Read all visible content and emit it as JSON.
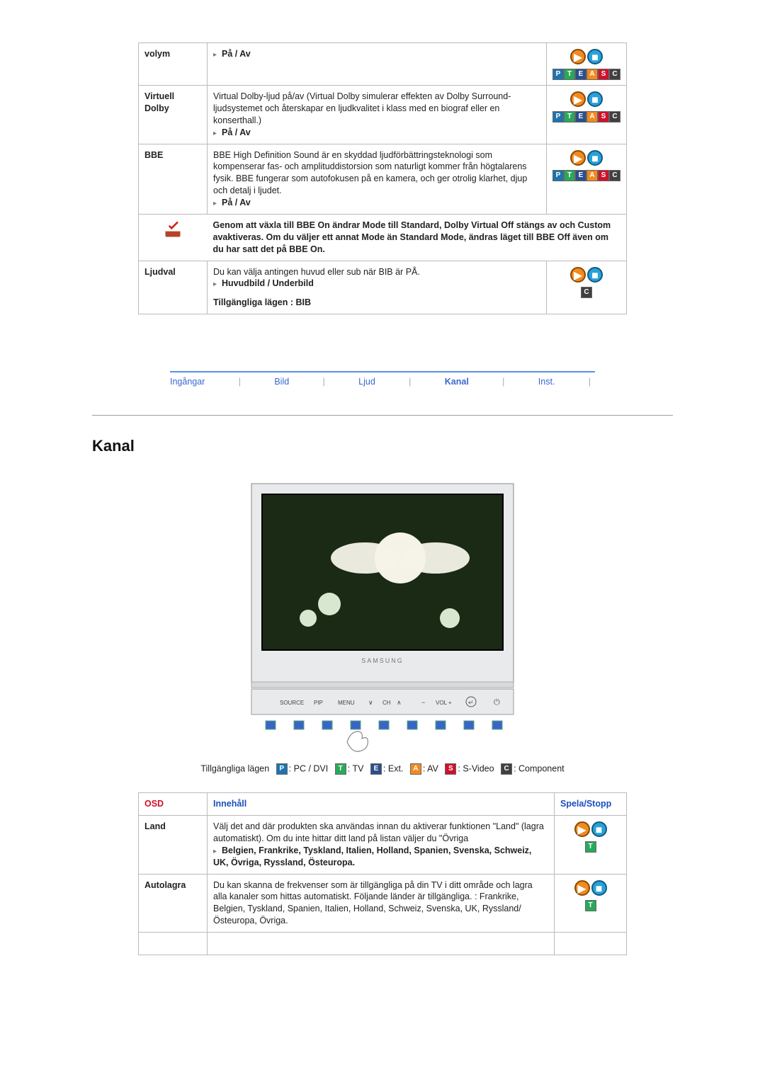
{
  "sound_table": {
    "rows": [
      {
        "label": "volym",
        "content_lines": [
          ""
        ],
        "option": "På / Av",
        "badges": [
          "P",
          "T",
          "E",
          "A",
          "S",
          "C"
        ]
      },
      {
        "label": "Virtuell Dolby",
        "content_lines": [
          "Virtual Dolby-ljud på/av (Virtual Dolby simulerar effekten av Dolby Surround-ljudsystemet och återskapar en ljudkvalitet i klass med en biograf eller en konserthall.)"
        ],
        "option": "På / Av",
        "badges": [
          "P",
          "T",
          "E",
          "A",
          "S",
          "C"
        ]
      },
      {
        "label": "BBE",
        "content_lines": [
          "BBE High Definition Sound är en skyddad ljudförbättringsteknologi som kompenserar fas- och amplituddistorsion som naturligt kommer från högtalarens fysik. BBE fungerar som autofokusen på en kamera, och ger otrolig klarhet, djup och detalj i ljudet."
        ],
        "option": "På / Av",
        "badges": [
          "P",
          "T",
          "E",
          "A",
          "S",
          "C"
        ]
      }
    ],
    "note": "Genom att växla till BBE On ändrar Mode till Standard, Dolby Virtual Off stängs av och Custom avaktiveras. Om du väljer ett annat Mode än Standard Mode, ändras läget till BBE Off även om du har satt det på BBE On.",
    "ljudval": {
      "label": "Ljudval",
      "line1": "Du kan välja antingen huvud eller sub när BIB är PÅ.",
      "option": "Huvudbild / Underbild",
      "avail": "Tillgängliga lägen : BIB",
      "badge": "C"
    }
  },
  "tabs": {
    "items": [
      "Ingångar",
      "Bild",
      "Ljud",
      "Kanal",
      "Inst."
    ],
    "selected": "Kanal"
  },
  "section_title": "Kanal",
  "tv": {
    "brand": "SAMSUNG",
    "buttons": [
      "SOURCE",
      "PIP",
      "MENU",
      "CH",
      "VOL +"
    ],
    "ch_down": "∨",
    "ch_up": "∧",
    "vol_minus": "−",
    "enter": "↵",
    "power": "⏻"
  },
  "legend": {
    "prefix": "Tillgängliga lägen",
    "items": [
      {
        "b": "P",
        "t": ": PC / DVI"
      },
      {
        "b": "T",
        "t": ": TV"
      },
      {
        "b": "E",
        "t": ": Ext."
      },
      {
        "b": "A",
        "t": ": AV"
      },
      {
        "b": "S",
        "t": ": S-Video"
      },
      {
        "b": "C",
        "t": ": Component"
      }
    ]
  },
  "kanal_table": {
    "headers": {
      "osd": "OSD",
      "innehall": "Innehåll",
      "spela": "Spela/Stopp"
    },
    "rows": [
      {
        "label": "Land",
        "content": "Välj det and där produkten ska användas innan du aktiverar funktionen \"Land\" (lagra automatiskt). Om du inte hittar ditt land på listan väljer du \"Övriga",
        "option": "Belgien, Frankrike, Tyskland, Italien, Holland, Spanien, Svenska, Schweiz, UK, Övriga, Ryssland, Östeuropa.",
        "badge": "T"
      },
      {
        "label": "Autolagra",
        "content": "Du kan skanna de frekvenser som är tillgängliga på din TV i ditt område och lagra alla kanaler som hittas automatiskt. Följande länder är tillgängliga. : Frankrike, Belgien, Tyskland, Spanien, Italien, Holland, Schweiz, Svenska, UK, Ryssland/Östeuropa, Övriga.",
        "option": "",
        "badge": "T"
      }
    ]
  }
}
